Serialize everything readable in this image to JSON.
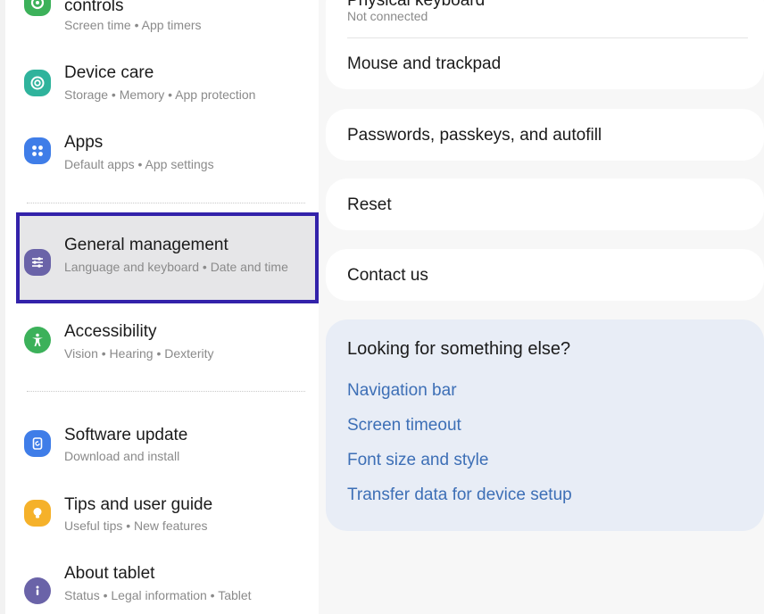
{
  "left_menu": {
    "items": [
      {
        "title": "controls",
        "subtitle": "Screen time  •  App timers"
      },
      {
        "title": "Device care",
        "subtitle": "Storage  •  Memory  •  App protection"
      },
      {
        "title": "Apps",
        "subtitle": "Default apps  •  App settings"
      },
      {
        "title": "General management",
        "subtitle": "Language and keyboard  •  Date and time"
      },
      {
        "title": "Accessibility",
        "subtitle": "Vision  •  Hearing  •  Dexterity"
      },
      {
        "title": "Software update",
        "subtitle": "Download and install"
      },
      {
        "title": "Tips and user guide",
        "subtitle": "Useful tips  •  New features"
      },
      {
        "title": "About tablet",
        "subtitle": "Status  •  Legal information  •  Tablet"
      }
    ]
  },
  "icons": {
    "digital_wellbeing": "wellbeing-icon",
    "device_care": "device-care-icon",
    "apps": "apps-icon",
    "general_management": "sliders-icon",
    "accessibility": "accessibility-icon",
    "software_update": "update-icon",
    "tips": "lightbulb-icon",
    "about": "info-icon"
  },
  "colors": {
    "wellbeing": "#3cb15a",
    "device_care": "#2fb39c",
    "apps": "#3f7de8",
    "general_management": "#6a63a8",
    "accessibility": "#3cb15a",
    "software_update": "#3f7de8",
    "tips": "#f5b12a",
    "about": "#6a63a8",
    "selection_border": "#3322aa",
    "link": "#3d6fb6"
  },
  "right_panel": {
    "keyboard": {
      "title": "Physical keyboard",
      "subtitle": "Not connected"
    },
    "mouse": "Mouse and trackpad",
    "passwords": "Passwords, passkeys, and autofill",
    "reset": "Reset",
    "contact": "Contact us",
    "suggestions": {
      "heading": "Looking for something else?",
      "links": [
        "Navigation bar",
        "Screen timeout",
        "Font size and style",
        "Transfer data for device setup"
      ]
    }
  }
}
